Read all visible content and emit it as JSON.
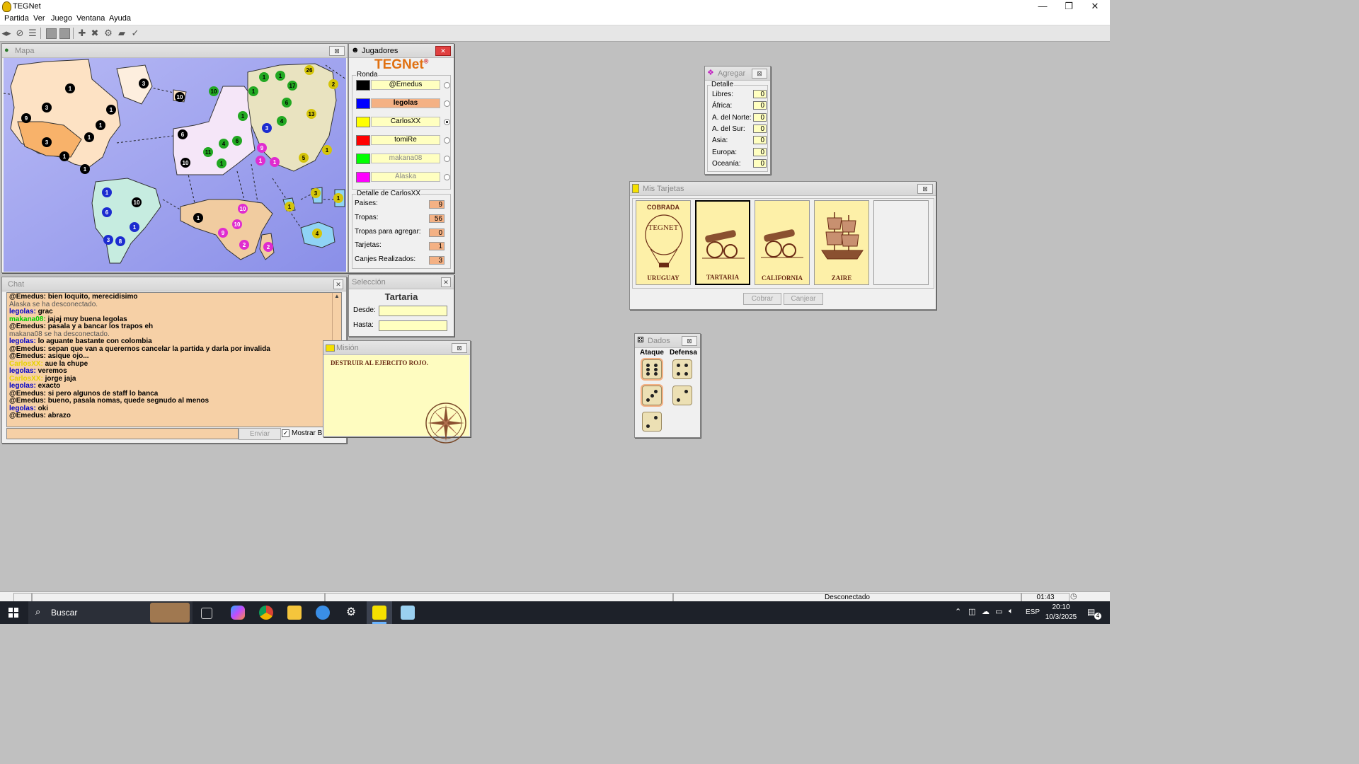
{
  "app": {
    "title": "TEGNet",
    "minimize": "—",
    "restore": "❐",
    "close": "✕"
  },
  "menu": [
    "Partida",
    "Ver",
    "Juego",
    "Ventana",
    "Ayuda"
  ],
  "map_window": {
    "title": "Mapa"
  },
  "players_window": {
    "title": "Jugadores",
    "logo": "TEGNet",
    "logo_mark": "®",
    "round_label": "Ronda",
    "players": [
      {
        "name": "@Emedus",
        "color": "#000000",
        "selected": false,
        "active": false
      },
      {
        "name": "legolas",
        "color": "#0000ff",
        "selected": false,
        "active": true
      },
      {
        "name": "CarlosXX",
        "color": "#ffff00",
        "selected": true,
        "active": false
      },
      {
        "name": "tomiRe",
        "color": "#ff0000",
        "selected": false,
        "active": false
      },
      {
        "name": "makana08",
        "color": "#00ff00",
        "selected": false,
        "active": false
      },
      {
        "name": "Alaska",
        "color": "#ff00ff",
        "selected": false,
        "active": false
      }
    ],
    "detail_label": "Detalle de CarlosXX",
    "details": [
      {
        "label": "Paises:",
        "value": "9"
      },
      {
        "label": "Tropas:",
        "value": "56"
      },
      {
        "label": "Tropas para agregar:",
        "value": "0"
      },
      {
        "label": "Tarjetas:",
        "value": "1"
      },
      {
        "label": "Canjes Realizados:",
        "value": "3"
      }
    ]
  },
  "agregar_window": {
    "title": "Agregar",
    "group": "Detalle",
    "rows": [
      {
        "label": "Libres:",
        "value": "0"
      },
      {
        "label": "África:",
        "value": "0"
      },
      {
        "label": "A. del Norte:",
        "value": "0"
      },
      {
        "label": "A. del Sur:",
        "value": "0"
      },
      {
        "label": "Asia:",
        "value": "0"
      },
      {
        "label": "Europa:",
        "value": "0"
      },
      {
        "label": "Oceanía:",
        "value": "0"
      }
    ]
  },
  "cards_window": {
    "title": "Mis Tarjetas",
    "cards": [
      {
        "name": "URUGUAY",
        "badge": "COBRADA",
        "art": "TEGNET",
        "selected": false
      },
      {
        "name": "TARTARIA",
        "badge": "",
        "art": "cannon",
        "selected": true
      },
      {
        "name": "CALIFORNIA",
        "badge": "",
        "art": "cannon",
        "selected": false
      },
      {
        "name": "ZAIRE",
        "badge": "",
        "art": "ship",
        "selected": false
      }
    ],
    "cobrar": "Cobrar",
    "canjear": "Canjear"
  },
  "dice_window": {
    "title": "Dados",
    "attack_label": "Ataque",
    "defense_label": "Defensa",
    "attack": [
      6,
      3,
      2
    ],
    "defense": [
      4,
      2
    ]
  },
  "chat_window": {
    "title": "Chat",
    "lines": [
      {
        "who": "@Emedus",
        "kind": "e",
        "text": "bien loquito, merecidisimo"
      },
      {
        "who": "",
        "kind": "sys",
        "text": "Alaska se ha desconectado."
      },
      {
        "who": "legolas",
        "kind": "l",
        "text": "grac"
      },
      {
        "who": "makana08",
        "kind": "m",
        "text": "jajaj muy buena legolas"
      },
      {
        "who": "@Emedus",
        "kind": "e",
        "text": "pasala y a bancar los trapos eh"
      },
      {
        "who": "",
        "kind": "sys",
        "text": "makana08 se ha desconectado."
      },
      {
        "who": "legolas",
        "kind": "l",
        "text": "lo aguante bastante con colombia"
      },
      {
        "who": "@Emedus",
        "kind": "e",
        "text": "sepan que van a querernos cancelar la partida y darla por invalida"
      },
      {
        "who": "@Emedus",
        "kind": "e",
        "text": "asique ojo..."
      },
      {
        "who": "CarlosXX",
        "kind": "c",
        "text": "aue la  chupe"
      },
      {
        "who": "legolas",
        "kind": "l",
        "text": "veremos"
      },
      {
        "who": "CarlosXX",
        "kind": "c",
        "text": "jorge jaja"
      },
      {
        "who": "legolas",
        "kind": "l",
        "text": "exacto"
      },
      {
        "who": "@Emedus",
        "kind": "e",
        "text": "si pero algunos de staff lo banca"
      },
      {
        "who": "@Emedus",
        "kind": "e",
        "text": "bueno, pasala nomas, quede segnudo al menos"
      },
      {
        "who": "legolas",
        "kind": "l",
        "text": "oki"
      },
      {
        "who": "@Emedus",
        "kind": "e",
        "text": "abrazo"
      }
    ],
    "send": "Enviar",
    "show_log": "Mostrar Bitá",
    "show_log_checked": true
  },
  "selection_window": {
    "title": "Selección",
    "country": "Tartaria",
    "from_label": "Desde:",
    "to_label": "Hasta:",
    "from_value": "",
    "to_value": ""
  },
  "mission_window": {
    "title": "Misión",
    "text": "DESTRUIR AL EJERCITO ROJO."
  },
  "statusbar": {
    "connection": "Desconectado",
    "time": "01:43"
  },
  "taskbar": {
    "search": "Buscar",
    "lang": "ESP",
    "clock": "20:10",
    "date": "10/3/2025",
    "notif": "4"
  }
}
